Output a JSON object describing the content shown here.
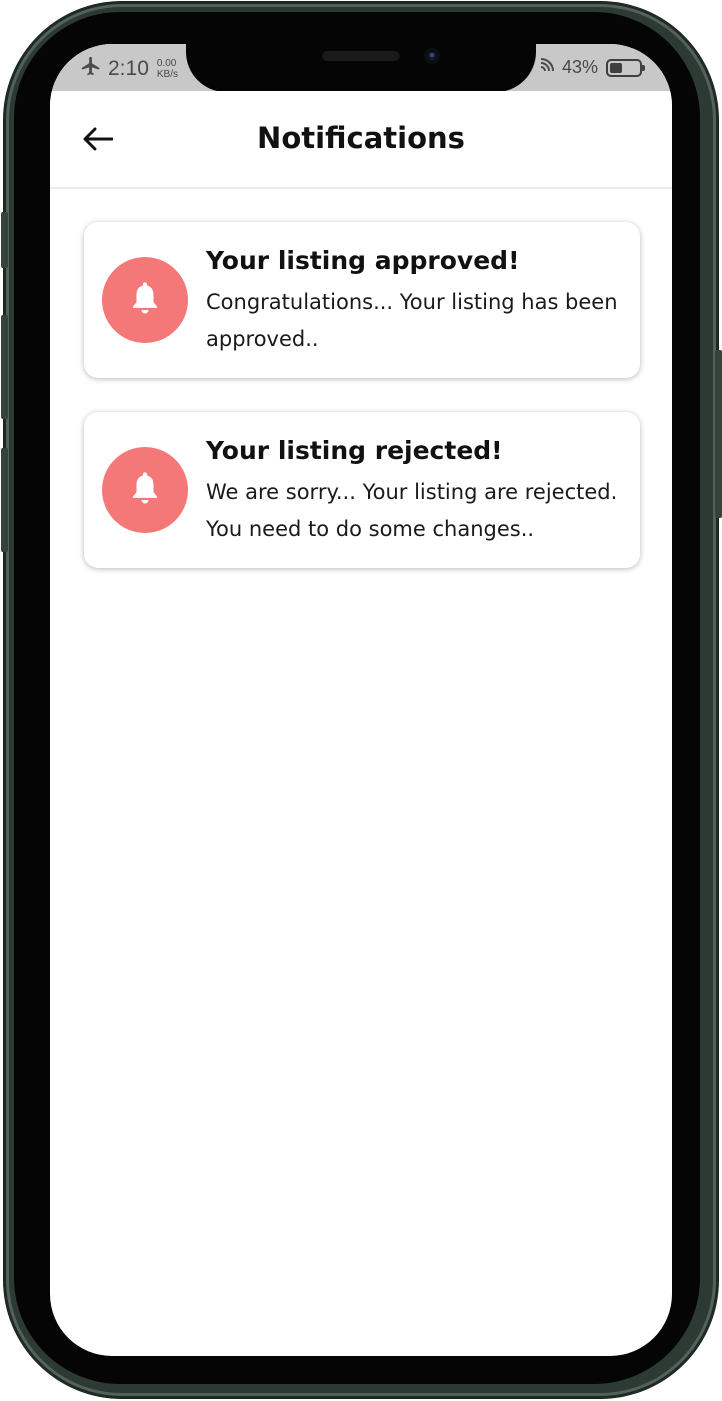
{
  "status_bar": {
    "time": "2:10",
    "net_speed_value": "0.00",
    "net_speed_unit": "KB/s",
    "battery_percent_label": "43%",
    "battery_level": 0.43
  },
  "header": {
    "title": "Notifications"
  },
  "notifications": [
    {
      "title": "Your listing approved!",
      "body": "Congratulations... Your listing has been approved.."
    },
    {
      "title": "Your listing rejected!",
      "body": "We are sorry... Your listing are rejected. You need to do some changes.."
    }
  ],
  "icons": {
    "back": "arrow-left-icon",
    "notification": "bell-icon",
    "airplane": "airplane-icon",
    "wifi": "wifi-icon",
    "battery": "battery-icon"
  },
  "colors": {
    "accent": "#f47878",
    "frame": "#2c3a33",
    "status_bar": "#c8c8c8"
  }
}
